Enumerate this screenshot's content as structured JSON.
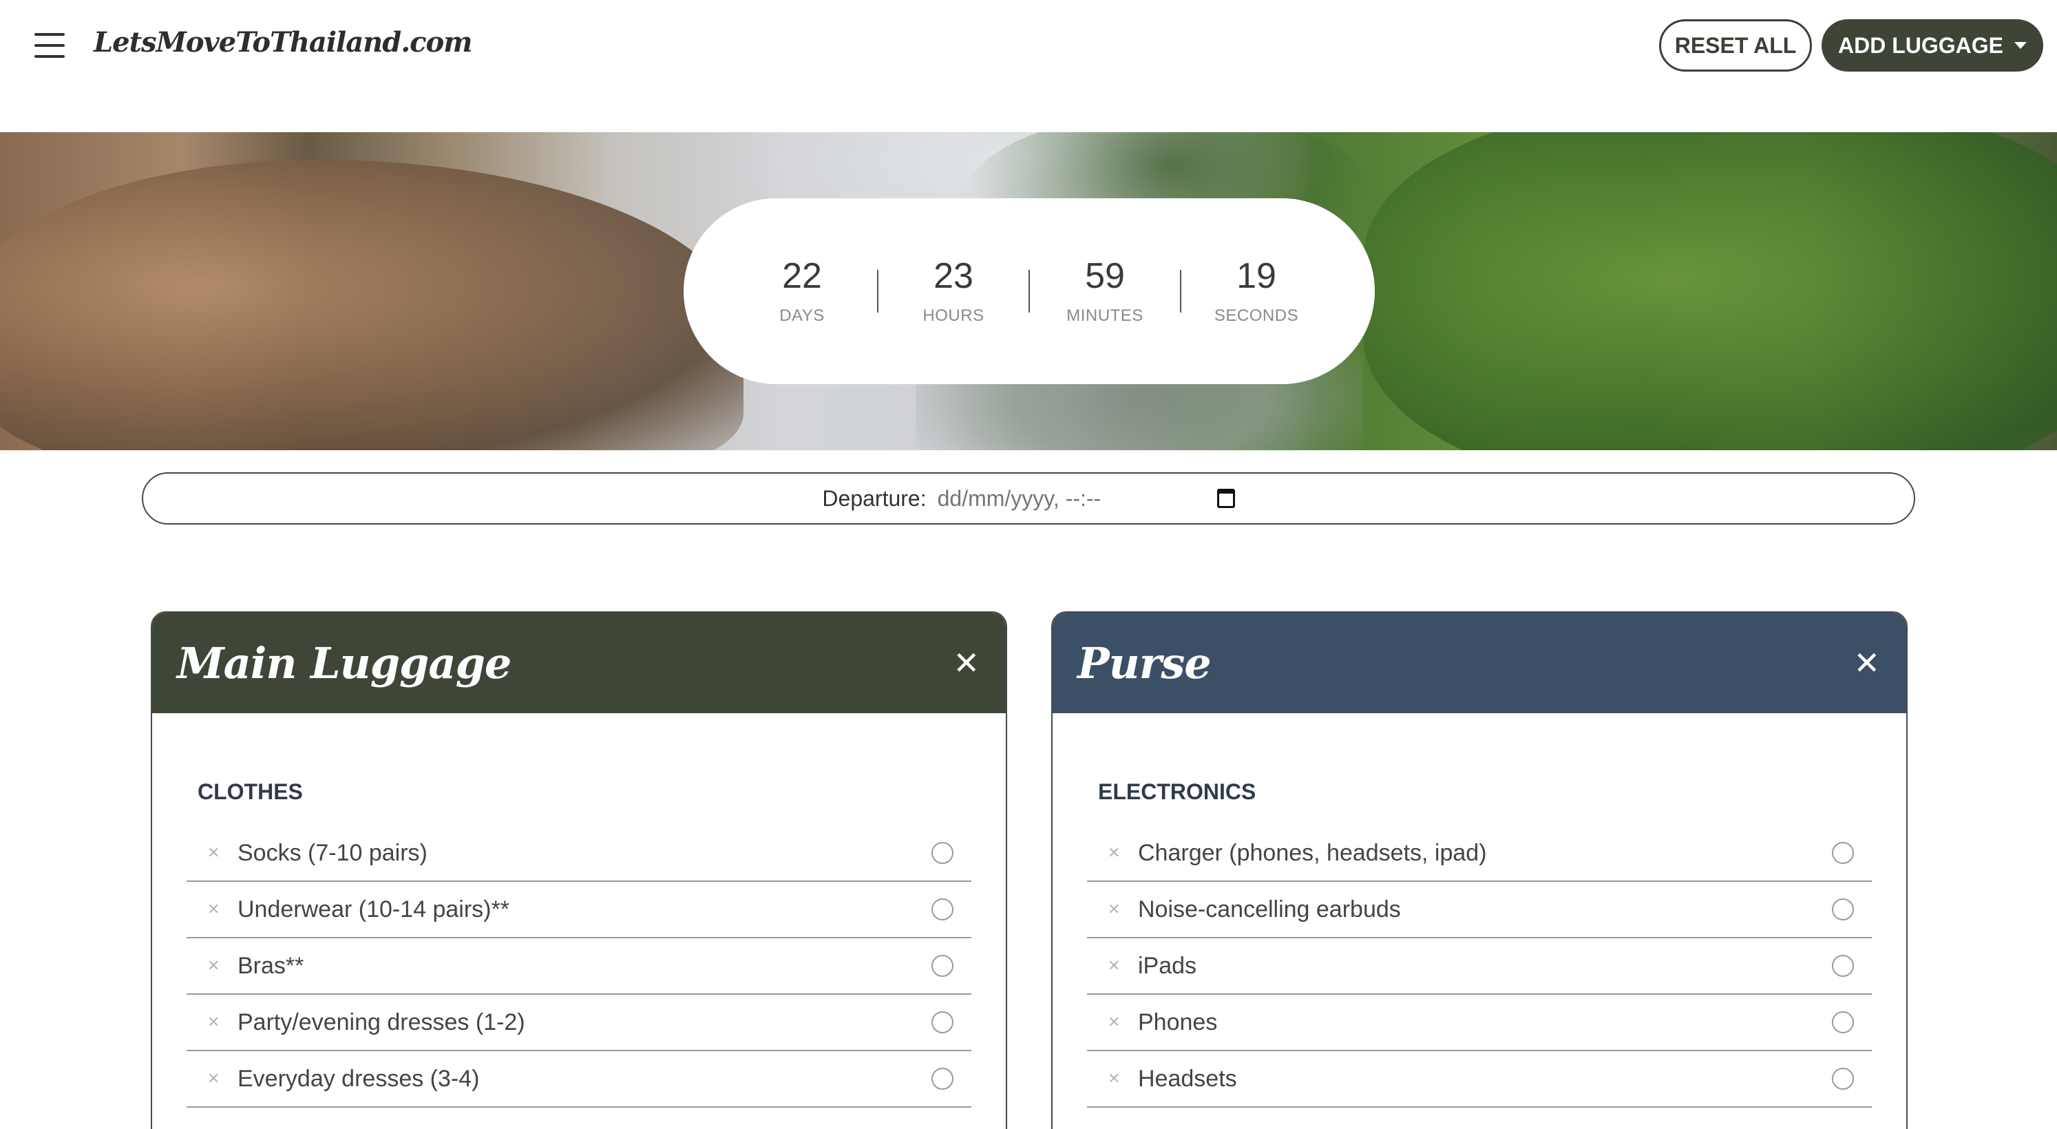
{
  "header": {
    "brand": "LetsMoveToThailand.com",
    "reset_label": "RESET ALL",
    "add_label": "ADD LUGGAGE"
  },
  "countdown": {
    "days": "22",
    "days_label": "DAYS",
    "hours": "23",
    "hours_label": "HOURS",
    "minutes": "59",
    "minutes_label": "MINUTES",
    "seconds": "19",
    "seconds_label": "SECONDS"
  },
  "departure": {
    "label": "Departure:",
    "placeholder": "dd/mm/yyyy, --:--"
  },
  "cards": [
    {
      "title": "Main Luggage",
      "section": "CLOTHES",
      "items": [
        {
          "label": "Socks (7-10 pairs)"
        },
        {
          "label": "Underwear (10-14 pairs)**"
        },
        {
          "label": "Bras**"
        },
        {
          "label": "Party/evening dresses (1-2)"
        },
        {
          "label": "Everyday dresses (3-4)"
        }
      ]
    },
    {
      "title": "Purse",
      "section": "ELECTRONICS",
      "items": [
        {
          "label": "Charger (phones, headsets, ipad)"
        },
        {
          "label": "Noise-cancelling earbuds"
        },
        {
          "label": "iPads"
        },
        {
          "label": "Phones"
        },
        {
          "label": "Headsets"
        }
      ]
    }
  ],
  "colors": {
    "main_header": "#3e4638",
    "purse_header": "#3b4f66",
    "add_button": "#3e4537"
  }
}
